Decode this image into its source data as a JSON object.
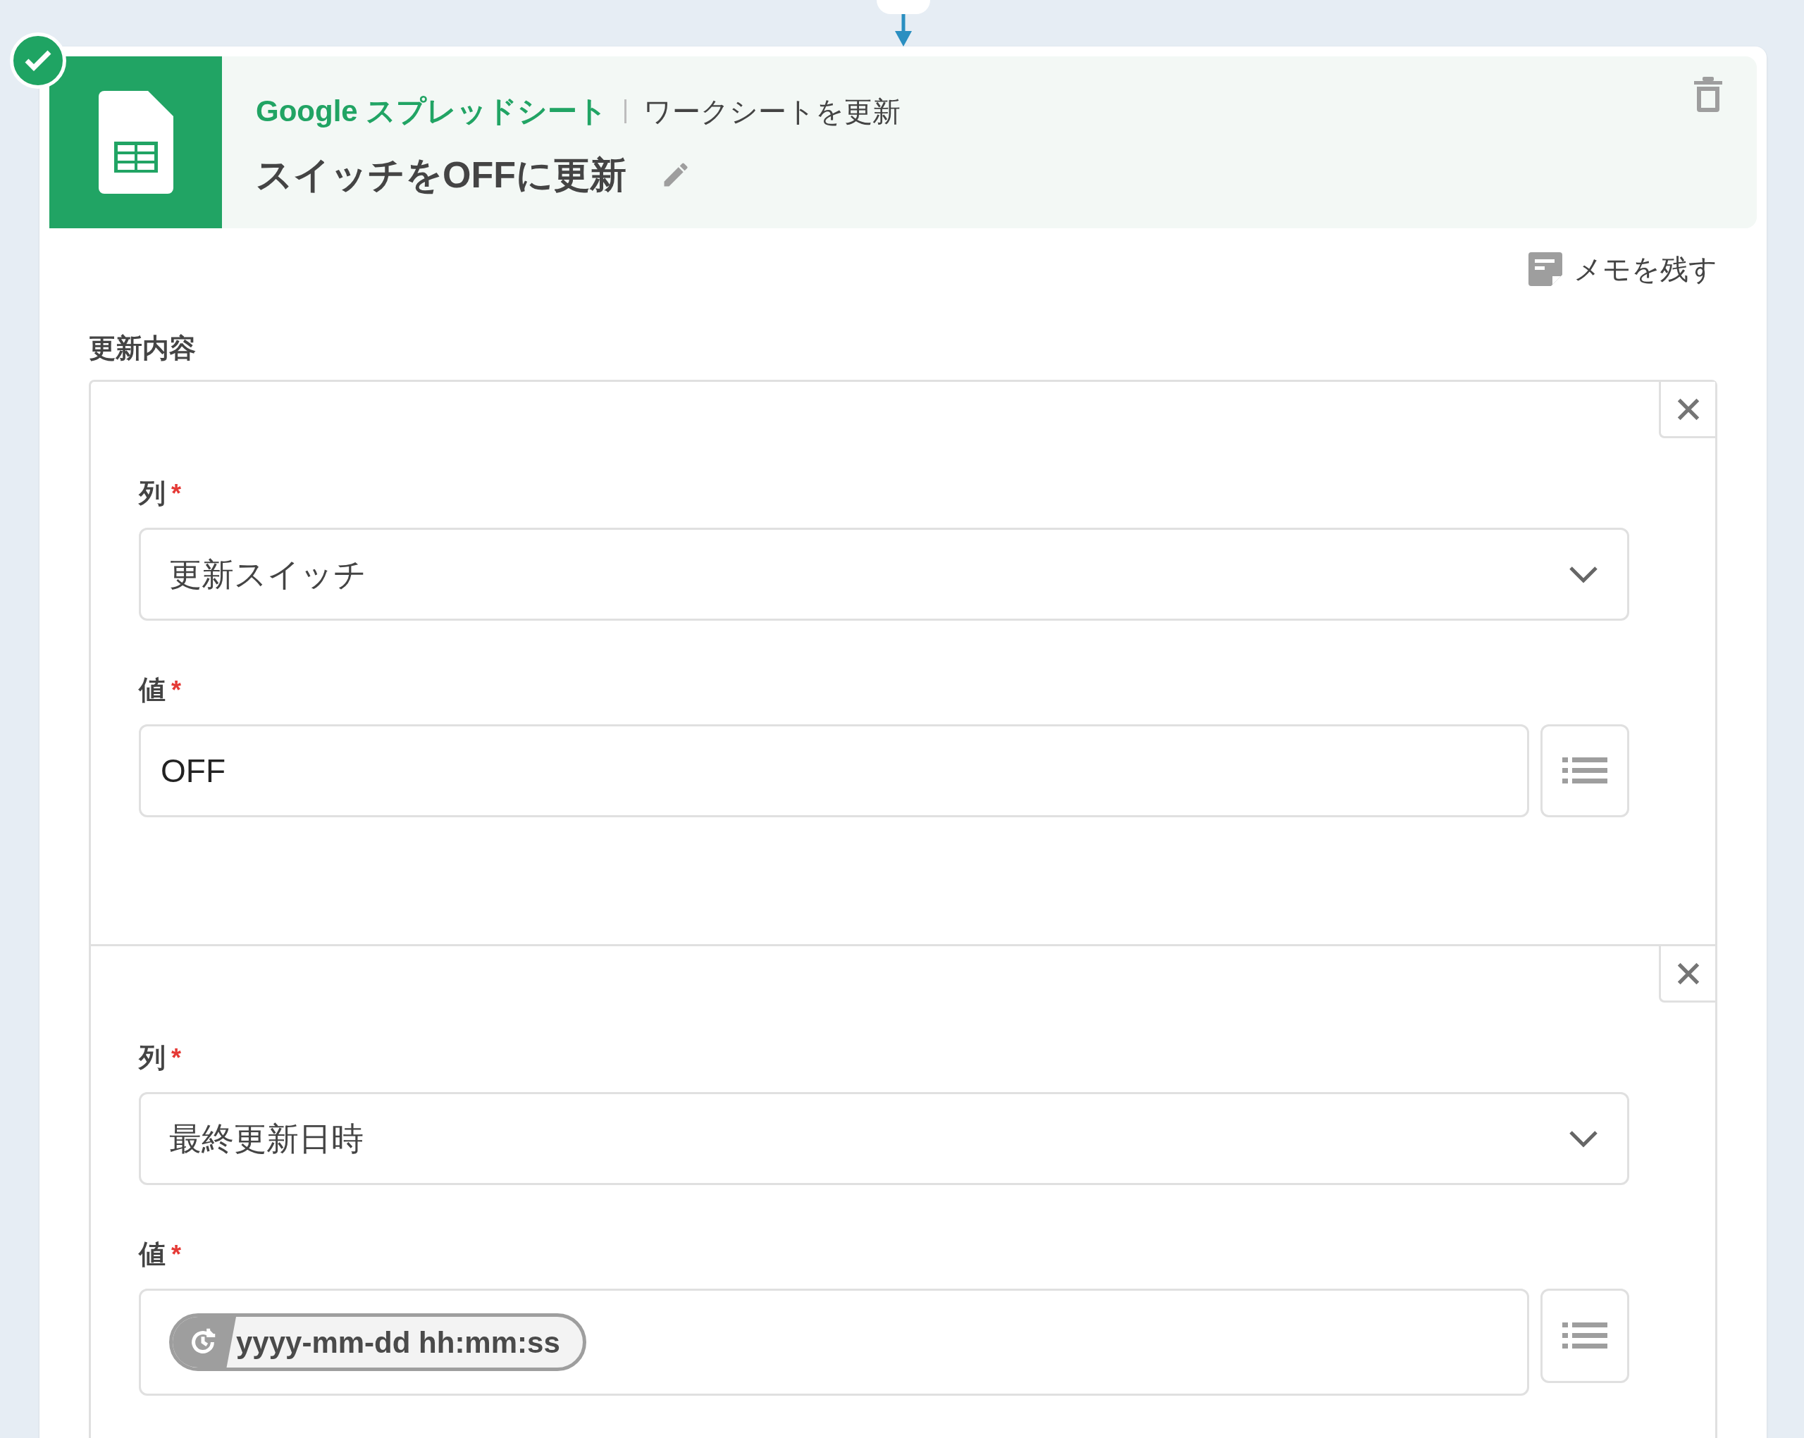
{
  "step": {
    "completed": true,
    "service": "Google スプレッドシート",
    "action": "ワークシートを更新",
    "title": "スイッチをOFFに更新"
  },
  "memo": "メモを残す",
  "section_label": "更新内容",
  "rows": [
    {
      "column_label": "列",
      "column_mark": "*",
      "column_value": "更新スイッチ",
      "value_label": "値",
      "value_mark": "*",
      "value": {
        "kind": "text",
        "text": "OFF"
      }
    },
    {
      "column_label": "列",
      "column_mark": "*",
      "column_value": "最終更新日時",
      "value_label": "値",
      "value_mark": "*",
      "value": {
        "kind": "chip",
        "text": "yyyy-mm-dd hh:mm:ss"
      }
    }
  ]
}
